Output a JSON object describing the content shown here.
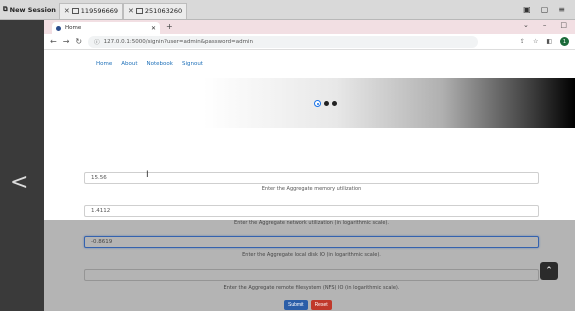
{
  "session_bar": {
    "label": "New Session",
    "tabs": [
      {
        "label": "119596669"
      },
      {
        "label": "251063260"
      }
    ]
  },
  "browser": {
    "tab_title": "Home",
    "url": "127.0.0.1:5000/signin?user=admin&password=admin",
    "profile_initial": "1"
  },
  "nav": {
    "items": [
      "Home",
      "About",
      "Notebook",
      "Signout"
    ]
  },
  "form": {
    "fields": [
      {
        "value": "15.56",
        "help": "Enter the Aggregate memory utilization"
      },
      {
        "value": "1.4112",
        "help": "Enter the Aggregate network utilization (in logarithmic scale)."
      },
      {
        "value": "-0.8619",
        "help": "Enter the Aggregate local disk IO (in logarithmic scale)."
      },
      {
        "value": "",
        "help": "Enter the Aggregate remote filesystem (NFS) IO (in logarithmic scale)."
      }
    ],
    "submit_label": "Submit",
    "reset_label": "Reset"
  },
  "icons": {
    "prev": "chevron-left-icon",
    "scroll_top": "chevron-up-icon"
  },
  "colors": {
    "accent": "#1a73e8",
    "submit": "#2b5ea8",
    "reset": "#c0392b"
  }
}
